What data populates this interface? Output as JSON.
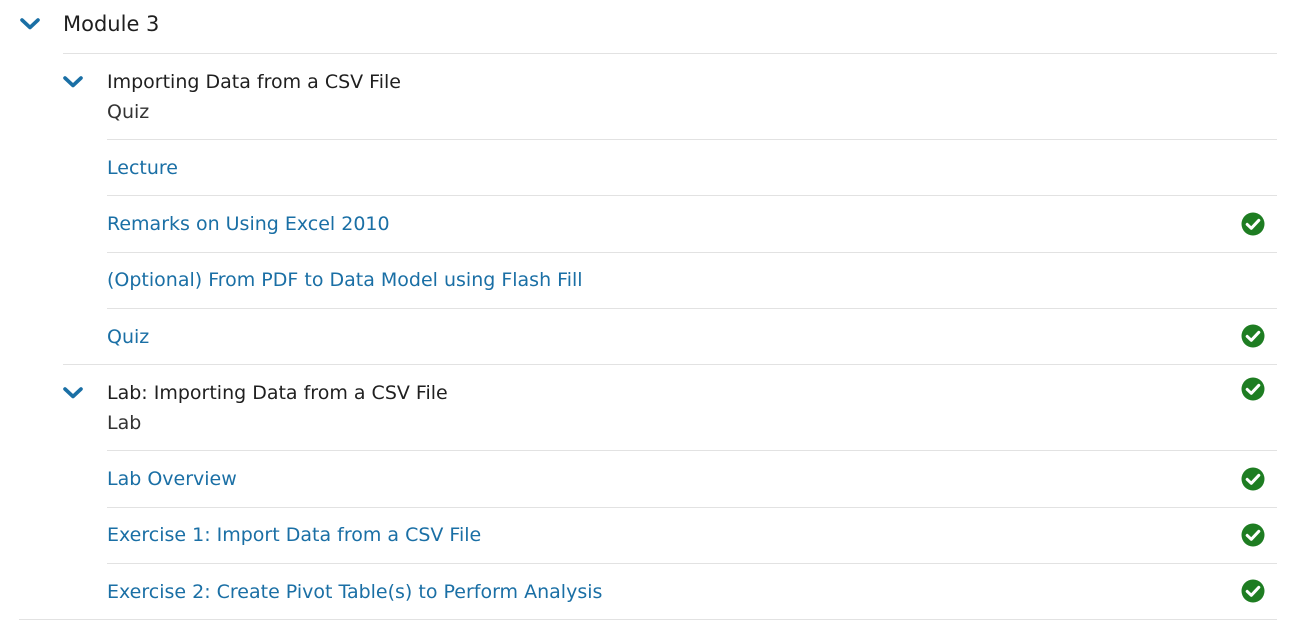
{
  "module": {
    "title": "Module 3"
  },
  "lessons": [
    {
      "title": "Importing Data from a CSV File",
      "type": "Quiz",
      "completed": false,
      "items": [
        {
          "label": "Lecture",
          "completed": false
        },
        {
          "label": "Remarks on Using Excel 2010",
          "completed": true
        },
        {
          "label": "(Optional) From PDF to Data Model using Flash Fill",
          "completed": false
        },
        {
          "label": "Quiz",
          "completed": true
        }
      ]
    },
    {
      "title": "Lab: Importing Data from a CSV File",
      "type": "Lab",
      "completed": true,
      "items": [
        {
          "label": "Lab Overview",
          "completed": true
        },
        {
          "label": "Exercise 1: Import Data from a CSV File",
          "completed": true
        },
        {
          "label": "Exercise 2: Create Pivot Table(s) to Perform Analysis",
          "completed": true
        }
      ]
    }
  ],
  "icons": {
    "expand": "chevron-down-icon",
    "complete": "check-circle-icon"
  },
  "colors": {
    "link": "#1a6fa5",
    "chevron": "#1a6fa5",
    "complete": "#1e7d22",
    "divider": "#e2e2e2",
    "text": "#1f1f1f"
  }
}
